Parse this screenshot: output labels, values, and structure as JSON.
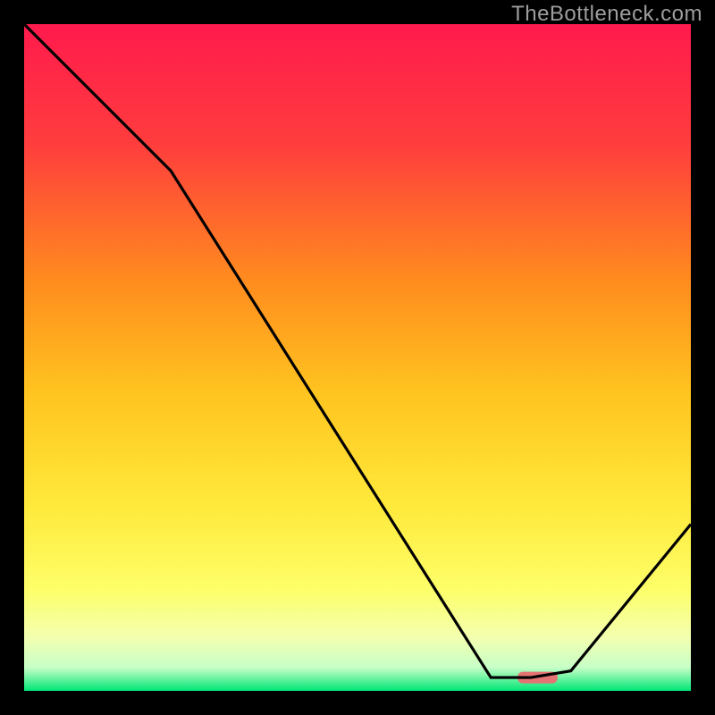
{
  "watermark": "TheBottleneck.com",
  "chart_data": {
    "type": "line",
    "title": "",
    "xlabel": "",
    "ylabel": "",
    "xlim": [
      0,
      100
    ],
    "ylim": [
      0,
      100
    ],
    "x": [
      0,
      22,
      70,
      76,
      82,
      100
    ],
    "values": [
      100,
      78,
      2,
      2,
      3,
      25
    ],
    "marker": {
      "x_start": 74,
      "x_end": 80,
      "y": 2
    },
    "gradient_stops": [
      {
        "offset": 0.0,
        "color": "#ff1a4d"
      },
      {
        "offset": 0.18,
        "color": "#ff3d3d"
      },
      {
        "offset": 0.38,
        "color": "#ff8a1f"
      },
      {
        "offset": 0.55,
        "color": "#ffc31f"
      },
      {
        "offset": 0.72,
        "color": "#ffe93a"
      },
      {
        "offset": 0.85,
        "color": "#fdff6a"
      },
      {
        "offset": 0.92,
        "color": "#f3ffb0"
      },
      {
        "offset": 0.965,
        "color": "#c7ffc7"
      },
      {
        "offset": 1.0,
        "color": "#00e676"
      }
    ],
    "marker_color": "#e57373",
    "line_color": "#000000"
  }
}
